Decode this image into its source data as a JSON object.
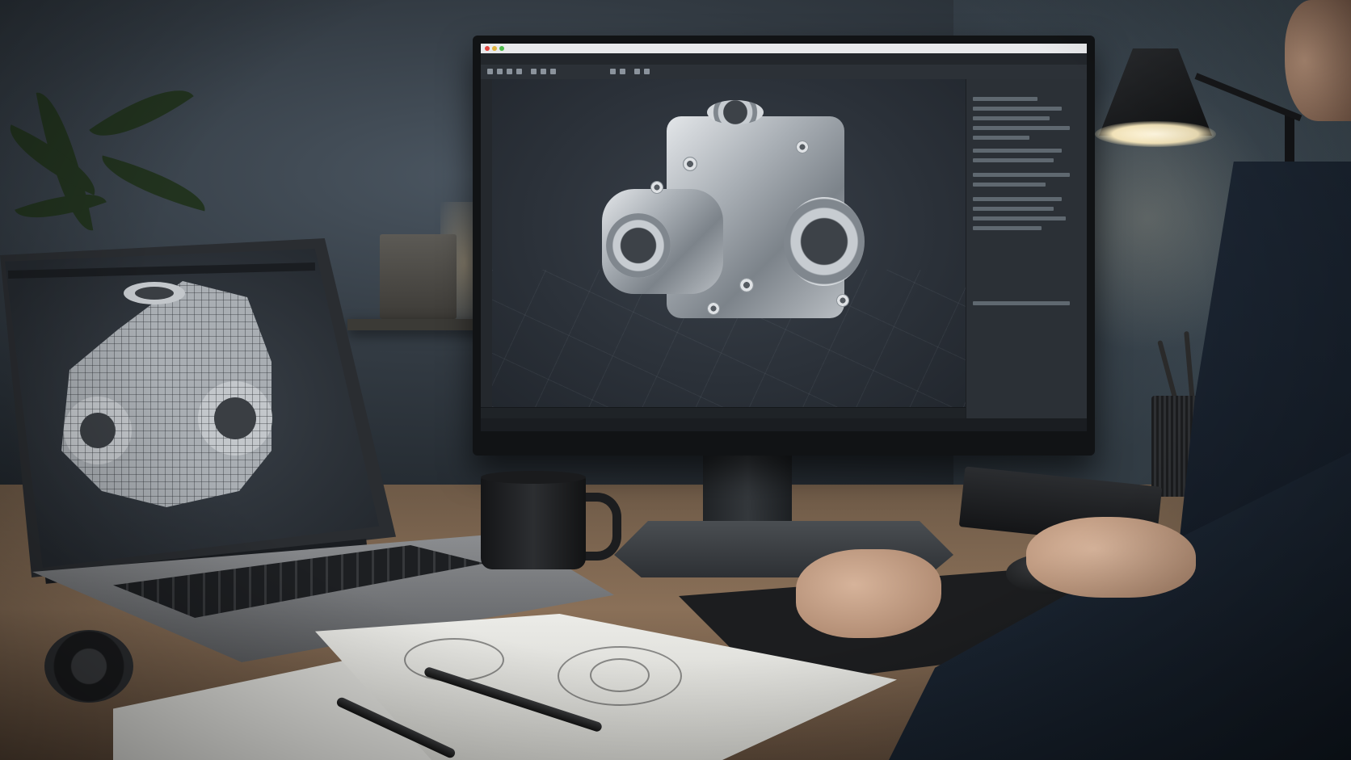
{
  "scene": {
    "description_tags": [
      "cad-workstation",
      "desk",
      "monitor",
      "laptop",
      "gearbox-model",
      "sketchbook",
      "desk-lamp",
      "coffee-mug",
      "mouse"
    ]
  },
  "colors": {
    "wall": "#323a42",
    "desk_wood": "#8a7058",
    "screen_bg": "#2a3038",
    "model_metal": "#aab0b6",
    "lamp_light": "#fff7e0",
    "sweater": "#1c2633"
  },
  "monitor": {
    "title_text": "",
    "panel_heading": "",
    "icons": [
      "window-close-icon",
      "window-minimize-icon",
      "window-maximize-icon"
    ]
  },
  "laptop": {
    "mode": "wireframe",
    "icons": [
      "toolbar-icon"
    ]
  }
}
